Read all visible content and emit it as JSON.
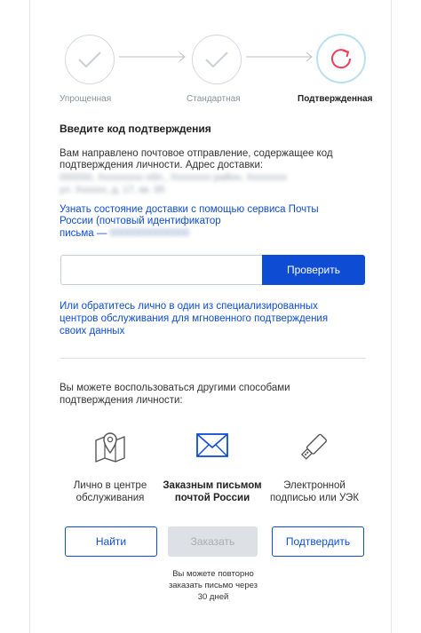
{
  "steps": [
    {
      "label": "Упрощенная",
      "state": "done"
    },
    {
      "label": "Стандартная",
      "state": "done"
    },
    {
      "label": "Подтвержденная",
      "state": "current"
    }
  ],
  "colors": {
    "primary": "#0d4cd3",
    "current_step": "#ee3f58",
    "done_step": "#cfd5db"
  },
  "confirm": {
    "title": "Введите код подтверждения",
    "intro_line1": "Вам направлено почтовое отправление, содержащее код",
    "intro_line2": "подтверждения личности. Адрес доставки:",
    "address_line1": "000000, Ххххххххх обл., Хххххххх район, Хххххххх",
    "address_line2": "ул. Хххххх, д. 17, кв. 95",
    "tracking_line1": "Узнать состояние доставки с помощью сервиса Почты",
    "tracking_line2": "России (почтовый идентификатор",
    "tracking_line3": "письма —",
    "tracking_id": "00000000000000",
    "code_value": "",
    "check_button": "Проверить",
    "center_link_line1": "Или обратитесь лично в один из специализированных",
    "center_link_line2": "центров обслуживания для мгновенного подтверждения",
    "center_link_line3": "своих данных"
  },
  "other": {
    "intro_line1": "Вы можете воспользоваться другими способами",
    "intro_line2": "подтверждения личности:",
    "options": [
      {
        "line1": "Лично в центре",
        "line2": "обслуживания",
        "icon": "map-pin-icon",
        "button": "Найти",
        "enabled": true
      },
      {
        "line1": "Заказным письмом",
        "line2": "почтой России",
        "icon": "envelope-icon",
        "button": "Заказать",
        "enabled": false
      },
      {
        "line1": "Электронной",
        "line2": "подписью или УЭК",
        "icon": "usb-key-icon",
        "button": "Подтвердить",
        "enabled": true
      }
    ],
    "note_line1": "Вы можете повторно",
    "note_line2": "заказать письмо через",
    "note_line3": "30 дней"
  }
}
